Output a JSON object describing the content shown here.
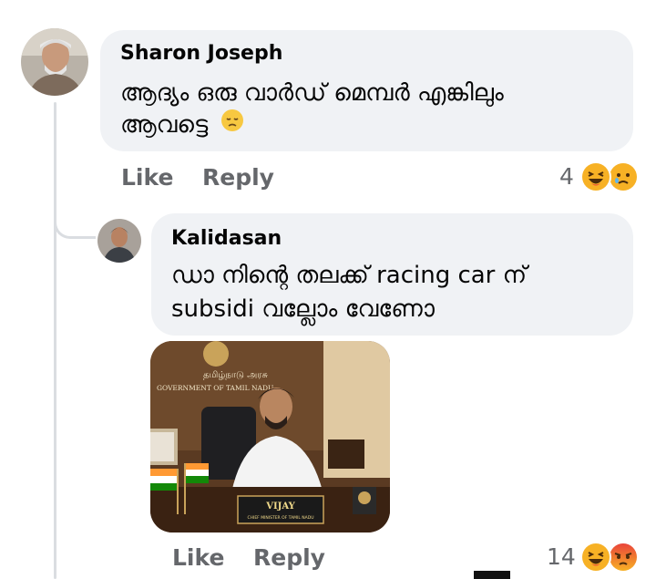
{
  "comments": [
    {
      "author": "Sharon Joseph",
      "lines": [
        "ആദ്യം ഒരു വാർഡ് മെമ്പർ എങ്കിലും",
        "ആവട്ടെ"
      ],
      "like_label": "Like",
      "reply_label": "Reply",
      "reaction_count": "4",
      "reactions": [
        "haha-icon",
        "sad-icon"
      ],
      "inline_emoji": "disappointed-face-icon"
    },
    {
      "author": "Kalidasan",
      "lines": [
        "ഡാ നിന്റെ തലക്ക് racing car ന്",
        "subsidi വല്ലോം വേണോ"
      ],
      "like_label": "Like",
      "reply_label": "Reply",
      "reaction_count": "14",
      "reactions": [
        "haha-icon",
        "angry-icon"
      ],
      "photo": {
        "sign_tamil": "தமிழ்நாடு அரசு",
        "sign_english": "GOVERNMENT OF TAMIL NADU",
        "nameplate_name": "VIJAY",
        "nameplate_title": "CHIEF MINISTER OF TAMIL NADU"
      }
    }
  ],
  "colors": {
    "bubble": "#f0f2f5",
    "secondary_text": "#65676b",
    "thread_line": "#dadde1",
    "reaction_yellow": "#f7b125",
    "reaction_red": "#e9443a"
  }
}
